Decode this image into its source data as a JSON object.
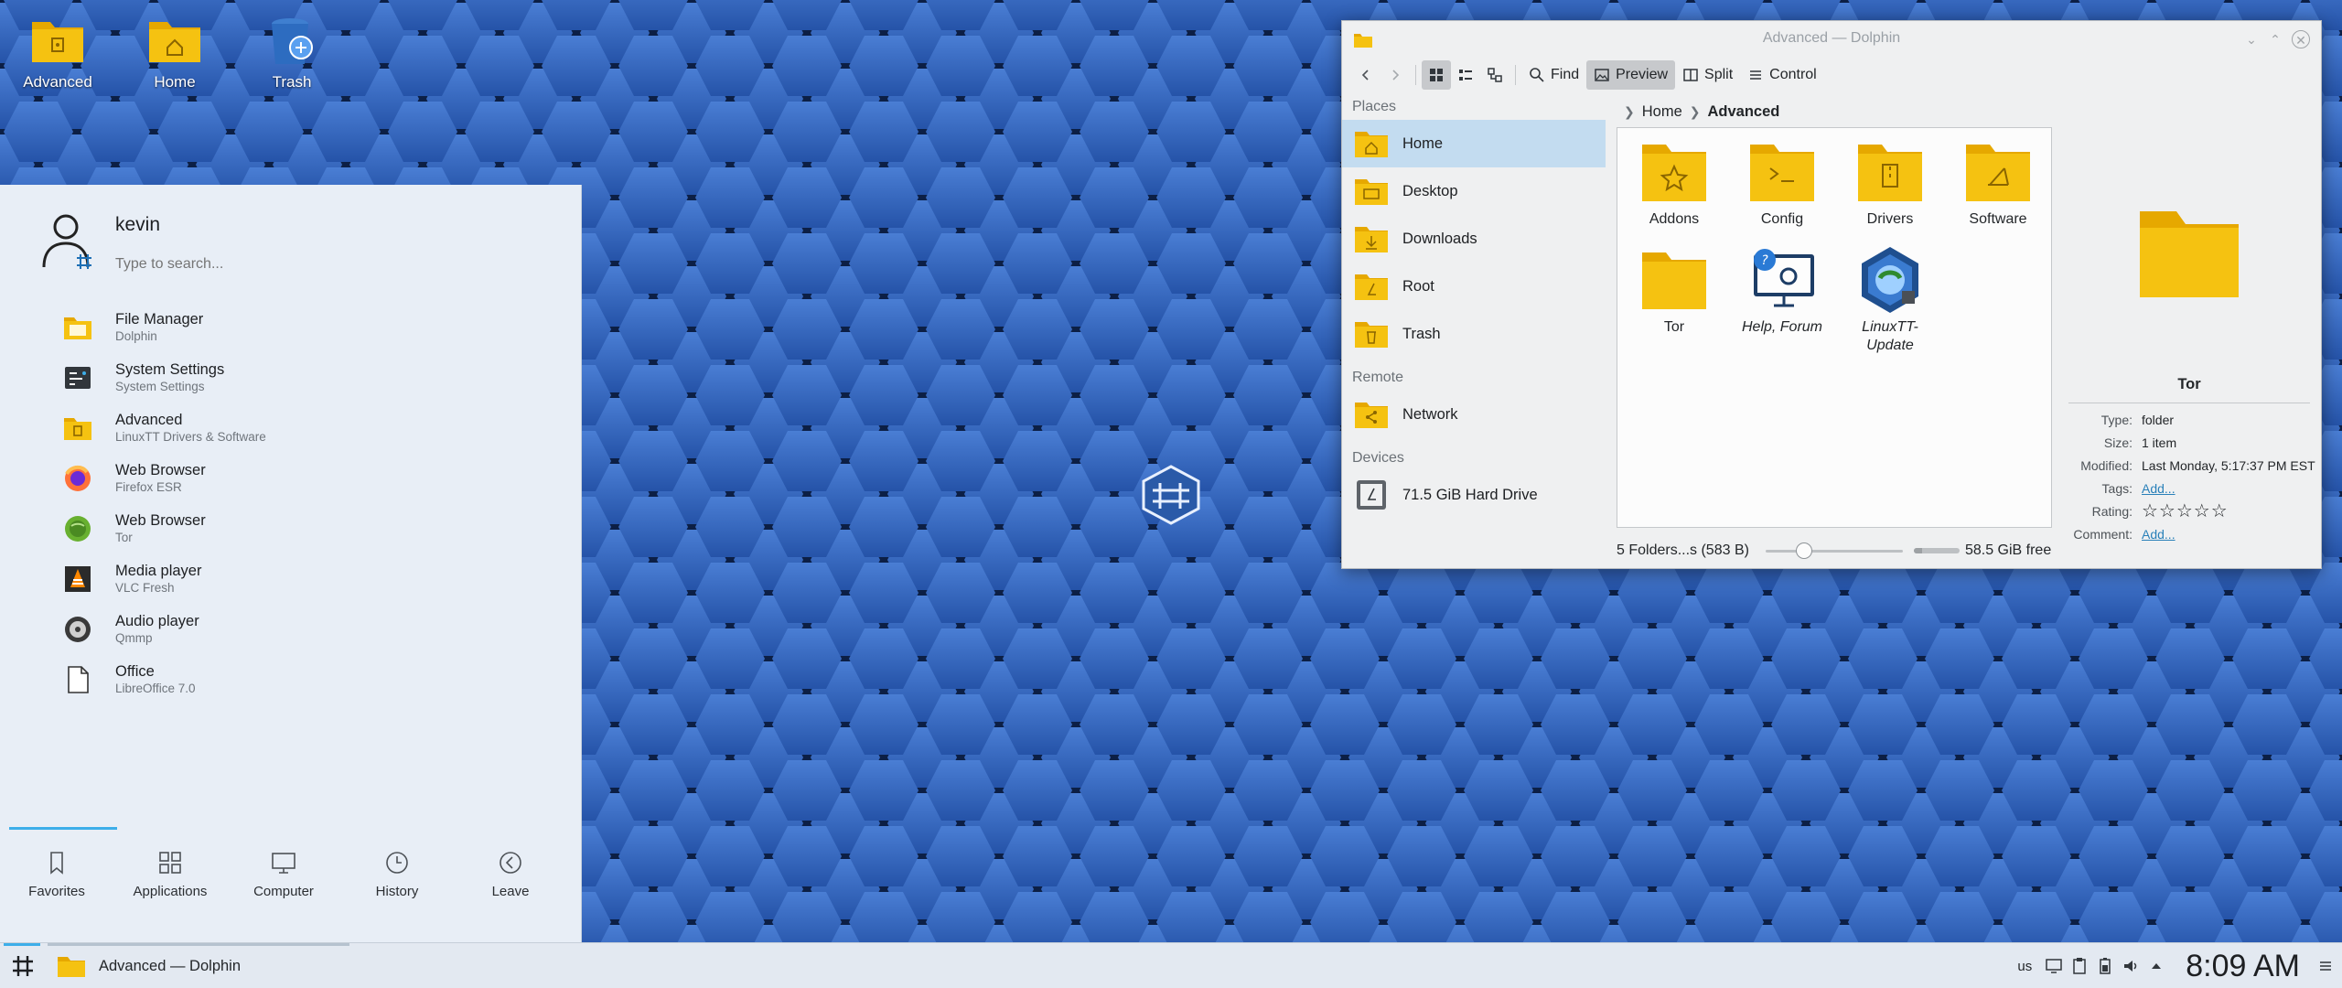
{
  "desktop": {
    "icons": [
      {
        "label": "Advanced",
        "icon": "folder-advanced-icon"
      },
      {
        "label": "Home",
        "icon": "folder-home-icon"
      },
      {
        "label": "Trash",
        "icon": "trash-icon"
      }
    ]
  },
  "launcher": {
    "user": "kevin",
    "search_placeholder": "Type to search...",
    "favorites": [
      {
        "name": "File Manager",
        "sub": "Dolphin",
        "icon": "file-manager-icon"
      },
      {
        "name": "System Settings",
        "sub": "System Settings",
        "icon": "system-settings-icon"
      },
      {
        "name": "Advanced",
        "sub": "LinuxTT Drivers & Software",
        "icon": "advanced-folder-icon"
      },
      {
        "name": "Web Browser",
        "sub": "Firefox ESR",
        "icon": "firefox-icon"
      },
      {
        "name": "Web Browser",
        "sub": "Tor",
        "icon": "tor-browser-icon"
      },
      {
        "name": "Media player",
        "sub": "VLC Fresh",
        "icon": "vlc-icon"
      },
      {
        "name": "Audio player",
        "sub": "Qmmp",
        "icon": "qmmp-icon"
      },
      {
        "name": "Office",
        "sub": "LibreOffice 7.0",
        "icon": "libreoffice-icon"
      }
    ],
    "tabs": [
      {
        "label": "Favorites",
        "icon": "bookmark-icon"
      },
      {
        "label": "Applications",
        "icon": "applications-grid-icon"
      },
      {
        "label": "Computer",
        "icon": "computer-monitor-icon"
      },
      {
        "label": "History",
        "icon": "clock-icon"
      },
      {
        "label": "Leave",
        "icon": "leave-arrow-icon"
      }
    ]
  },
  "dolphin": {
    "title": "Advanced — Dolphin",
    "toolbar": {
      "find": "Find",
      "preview": "Preview",
      "split": "Split",
      "control": "Control"
    },
    "places": {
      "places_header": "Places",
      "places_items": [
        {
          "label": "Home",
          "icon": "folder-home-icon",
          "selected": true
        },
        {
          "label": "Desktop",
          "icon": "folder-desktop-icon",
          "selected": false
        },
        {
          "label": "Downloads",
          "icon": "folder-downloads-icon",
          "selected": false
        },
        {
          "label": "Root",
          "icon": "folder-root-icon",
          "selected": false
        },
        {
          "label": "Trash",
          "icon": "trash-icon",
          "selected": false
        }
      ],
      "remote_header": "Remote",
      "remote_items": [
        {
          "label": "Network",
          "icon": "folder-network-icon"
        }
      ],
      "devices_header": "Devices",
      "devices_items": [
        {
          "label": "71.5 GiB Hard Drive",
          "icon": "hard-drive-icon"
        }
      ]
    },
    "breadcrumb": [
      "Home",
      "Advanced"
    ],
    "files": [
      {
        "label": "Addons",
        "icon": "folder-star-icon"
      },
      {
        "label": "Config",
        "icon": "folder-terminal-icon"
      },
      {
        "label": "Drivers",
        "icon": "folder-archive-icon"
      },
      {
        "label": "Software",
        "icon": "folder-tools-icon"
      },
      {
        "label": "Tor",
        "icon": "folder-icon"
      },
      {
        "label": "Help, Forum",
        "icon": "help-forum-icon",
        "italic": true
      },
      {
        "label": "LinuxTT-Update",
        "label_lines": [
          "LinuxTT-",
          "Update"
        ],
        "icon": "linuxtt-update-icon",
        "italic": true
      }
    ],
    "status": {
      "summary": "5 Folders...s (583 B)",
      "zoom_level": 0.25,
      "free": "58.5 GiB free",
      "used_fraction": 0.18
    },
    "info_panel": {
      "name": "Tor",
      "rows": [
        {
          "key": "Type:",
          "value": "folder"
        },
        {
          "key": "Size:",
          "value": "1 item"
        },
        {
          "key": "Modified:",
          "value": "Last Monday, 5:17:37 PM EST"
        },
        {
          "key": "Tags:",
          "value": "Add...",
          "link": true
        },
        {
          "key": "Rating:",
          "value": "☆☆☆☆☆",
          "stars": true,
          "rating": 0
        },
        {
          "key": "Comment:",
          "value": "Add...",
          "link": true
        }
      ]
    }
  },
  "taskbar": {
    "task_title": "Advanced — Dolphin",
    "keyboard_layout": "us",
    "clock": "8:09 AM"
  },
  "colors": {
    "accent": "#3daee9",
    "folder": "#f5c211",
    "selection": "#c3dcf0",
    "wallpaper": "#2f5fb6"
  }
}
